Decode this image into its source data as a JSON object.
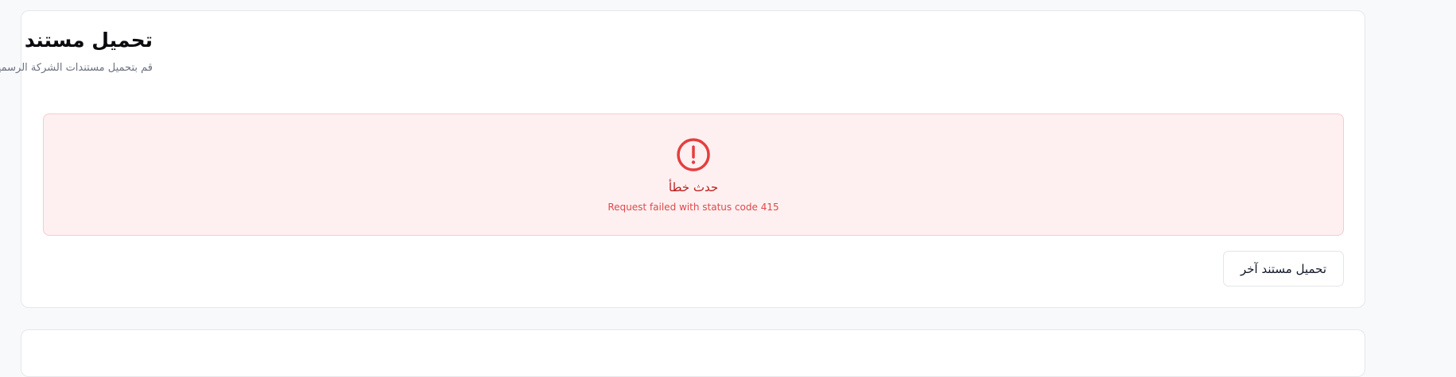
{
  "upload_card": {
    "title": "تحميل مستند",
    "subtitle": "قم بتحميل مستندات الشركة الرسمية (PDF فقط)"
  },
  "error": {
    "icon": "alert-circle-icon",
    "title": "حدث خطأ",
    "message": "Request failed with status code 415",
    "color": "#dc2626"
  },
  "actions": {
    "upload_another_label": "تحميل مستند آخر"
  }
}
